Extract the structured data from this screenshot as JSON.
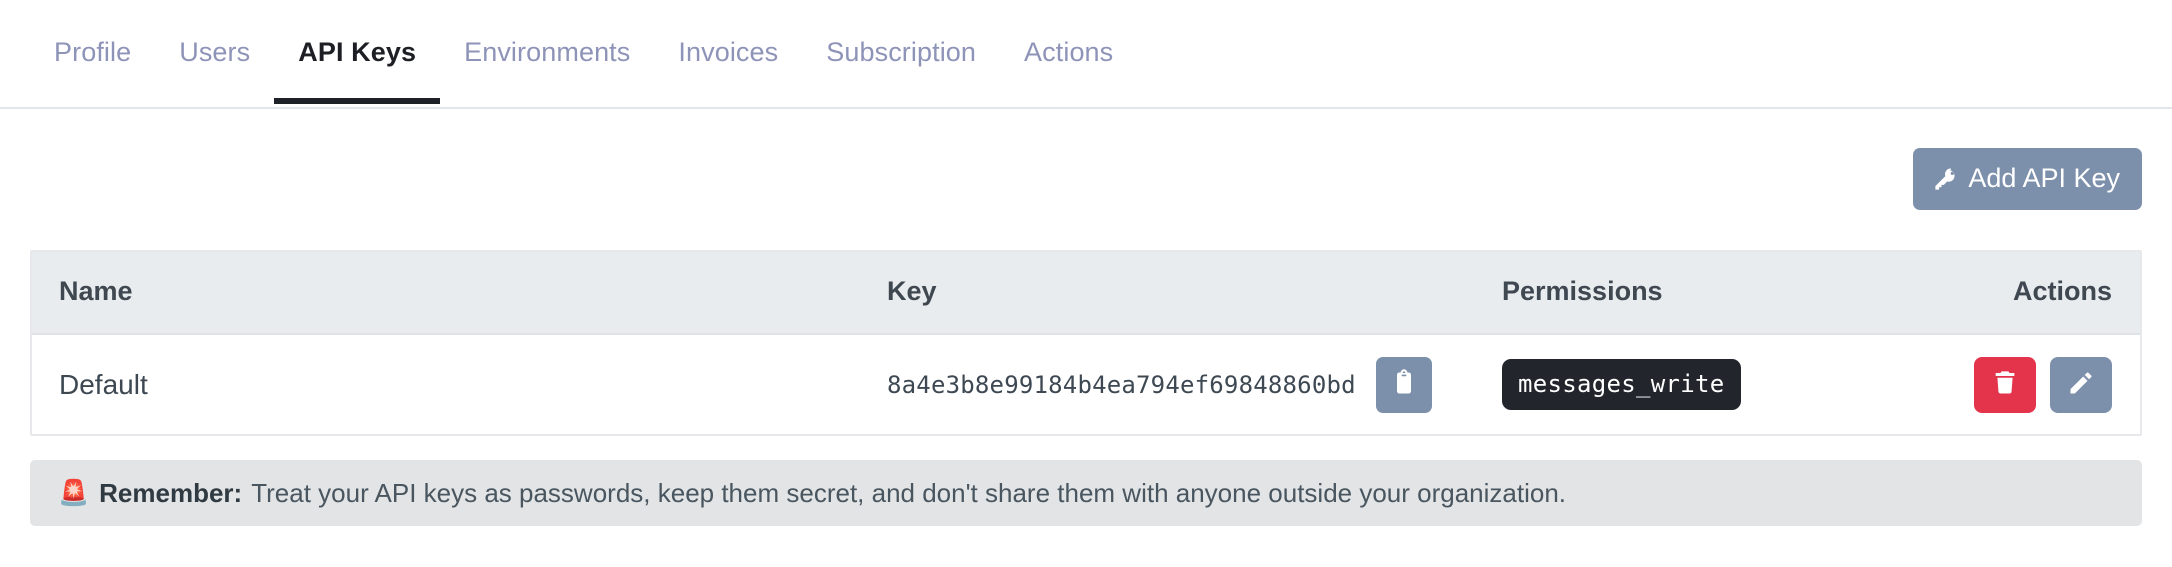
{
  "nav": {
    "tabs": [
      {
        "label": "Profile",
        "active": false
      },
      {
        "label": "Users",
        "active": false
      },
      {
        "label": "API Keys",
        "active": true
      },
      {
        "label": "Environments",
        "active": false
      },
      {
        "label": "Invoices",
        "active": false
      },
      {
        "label": "Subscription",
        "active": false
      },
      {
        "label": "Actions",
        "active": false
      }
    ]
  },
  "toolbar": {
    "add_key_label": "Add API Key",
    "add_key_icon": "key-icon"
  },
  "table": {
    "headers": {
      "name": "Name",
      "key": "Key",
      "permissions": "Permissions",
      "actions": "Actions"
    },
    "rows": [
      {
        "name": "Default",
        "key": "8a4e3b8e99184b4ea794ef69848860bd",
        "copy_icon": "clipboard-icon",
        "permissions": [
          "messages_write"
        ],
        "delete_icon": "trash-icon",
        "edit_icon": "pencil-icon"
      }
    ]
  },
  "alert": {
    "icon": "🚨",
    "icon_name": "siren-icon",
    "strong": "Remember:",
    "message": "Treat your API keys as passwords, keep them secret, and don't share them with anyone outside your organization."
  },
  "colors": {
    "accent_blue_gray": "#7d90ab",
    "danger_red": "#e3344c",
    "badge_dark": "#22262c",
    "tab_inactive": "#8e93b8",
    "tab_active": "#1d1f24",
    "table_header_bg": "#e8ecef",
    "alert_bg": "#e2e4e6"
  }
}
